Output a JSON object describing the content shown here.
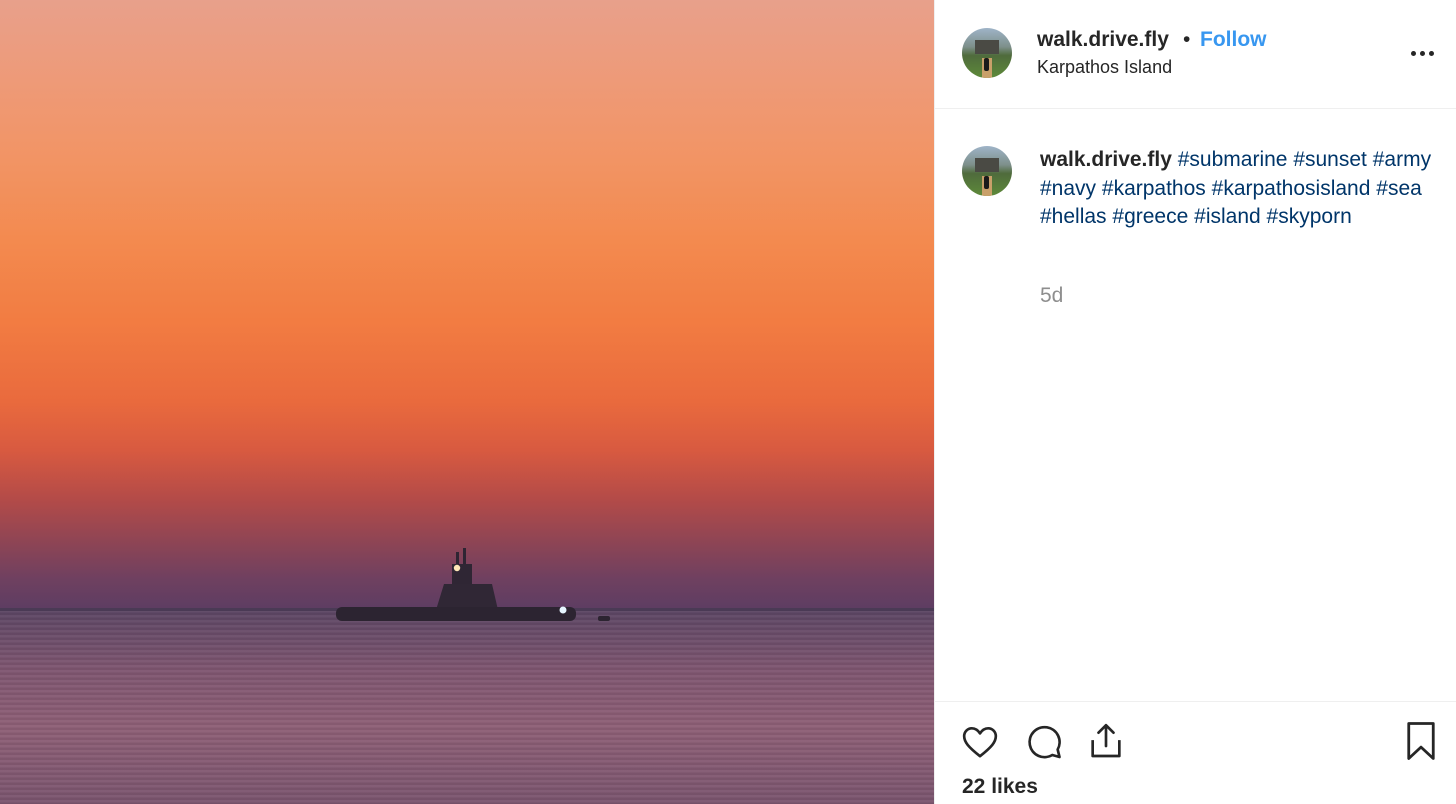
{
  "post": {
    "image_alt": "submarine at sunset",
    "header": {
      "username": "walk.drive.fly",
      "separator": "•",
      "follow_label": "Follow",
      "location": "Karpathos Island",
      "more_icon": "more-options-icon"
    },
    "caption": {
      "username": "walk.drive.fly",
      "hashtags": [
        "#submarine",
        "#sunset",
        "#army",
        "#navy",
        "#karpathos",
        "#karpathosisland",
        "#sea",
        "#hellas",
        "#greece",
        "#island",
        "#skyporn"
      ]
    },
    "age": "5d",
    "actions": {
      "icons": [
        "heart-icon",
        "comment-icon",
        "share-icon",
        "bookmark-icon"
      ]
    },
    "likes": "22 likes"
  },
  "colors": {
    "follow": "#3897f0",
    "hashtag": "#003569",
    "muted": "#8e8e8e",
    "text": "#262626"
  }
}
